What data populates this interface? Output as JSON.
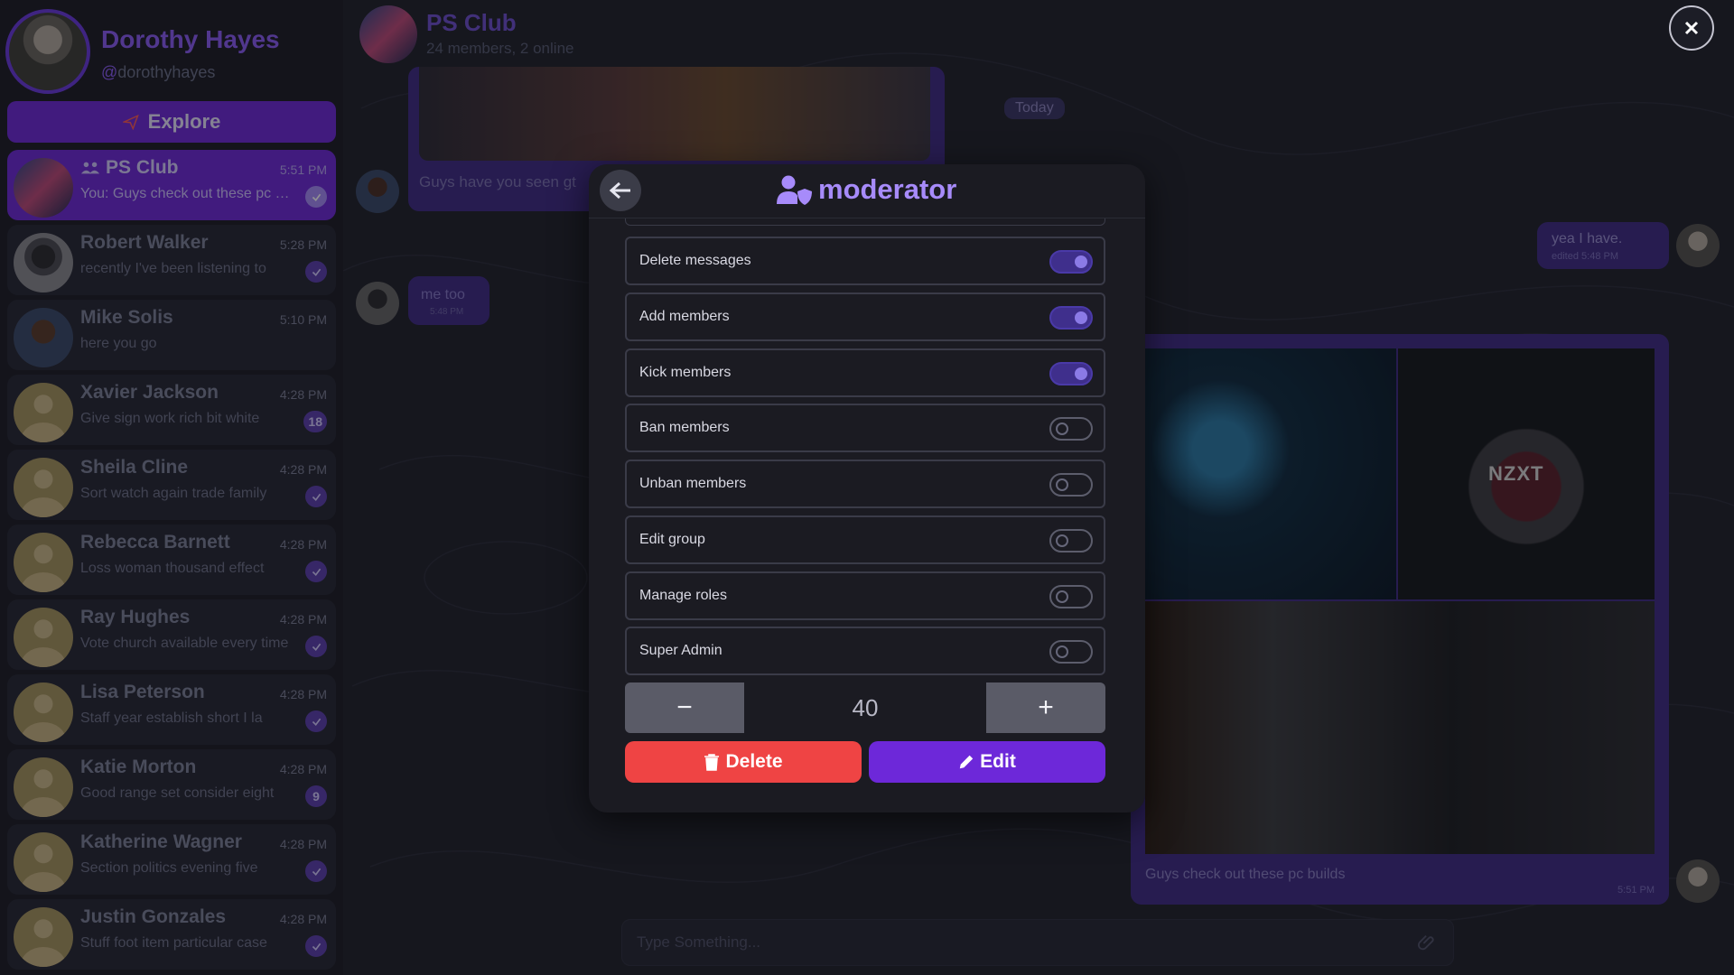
{
  "profile": {
    "name": "Dorothy Hayes",
    "handle": "dorothyhayes"
  },
  "sidebar": {
    "explore_label": "Explore",
    "chats": [
      {
        "title": "PS Club",
        "time": "5:51 PM",
        "preview": "You: Guys check out these pc builds",
        "badge": "",
        "active": true,
        "group": true
      },
      {
        "title": "Robert Walker",
        "time": "5:28 PM",
        "preview": "recently I've been listening to",
        "badge": ""
      },
      {
        "title": "Mike Solis",
        "time": "5:10 PM",
        "preview": "here you go",
        "badge": ""
      },
      {
        "title": "Xavier Jackson",
        "time": "4:28 PM",
        "preview": "Give sign work rich bit white",
        "badge": "18"
      },
      {
        "title": "Sheila Cline",
        "time": "4:28 PM",
        "preview": "Sort watch again trade family",
        "badge": ""
      },
      {
        "title": "Rebecca Barnett",
        "time": "4:28 PM",
        "preview": "Loss woman thousand effect",
        "badge": ""
      },
      {
        "title": "Ray Hughes",
        "time": "4:28 PM",
        "preview": "Vote church available every time",
        "badge": ""
      },
      {
        "title": "Lisa Peterson",
        "time": "4:28 PM",
        "preview": "Staff year establish short I la",
        "badge": ""
      },
      {
        "title": "Katie Morton",
        "time": "4:28 PM",
        "preview": "Good range set consider eight",
        "badge": "9"
      },
      {
        "title": "Katherine Wagner",
        "time": "4:28 PM",
        "preview": "Section politics evening five",
        "badge": ""
      },
      {
        "title": "Justin Gonzales",
        "time": "4:28 PM",
        "preview": "Stuff foot item particular case",
        "badge": ""
      }
    ]
  },
  "chat": {
    "title": "PS Club",
    "subtitle": "24 members, 2 online",
    "messages": {
      "guys_caption": "Guys have you seen gt",
      "me_too": "me too",
      "me_too_time": "5:48 PM",
      "today": "Today",
      "yea_text": "yea I have.",
      "yea_meta": "edited 5:48 PM",
      "pc_caption": "Guys check out these pc builds",
      "pc_time": "5:51 PM",
      "nzxt": "NZXT"
    },
    "composer_placeholder": "Type Something..."
  },
  "modal": {
    "title": "moderator",
    "permissions": [
      {
        "label": "Delete messages",
        "on": true
      },
      {
        "label": "Add members",
        "on": true
      },
      {
        "label": "Kick members",
        "on": true
      },
      {
        "label": "Ban members",
        "on": false
      },
      {
        "label": "Unban members",
        "on": false
      },
      {
        "label": "Edit group",
        "on": false
      },
      {
        "label": "Manage roles",
        "on": false
      },
      {
        "label": "Super Admin",
        "on": false
      }
    ],
    "stepper_value": "40",
    "minus": "−",
    "plus": "+",
    "delete_label": "Delete",
    "edit_label": "Edit"
  },
  "colors": {
    "accent": "#6d28d9",
    "accent_light": "#a78bfa",
    "danger": "#ef4444",
    "background": "#20212b"
  }
}
